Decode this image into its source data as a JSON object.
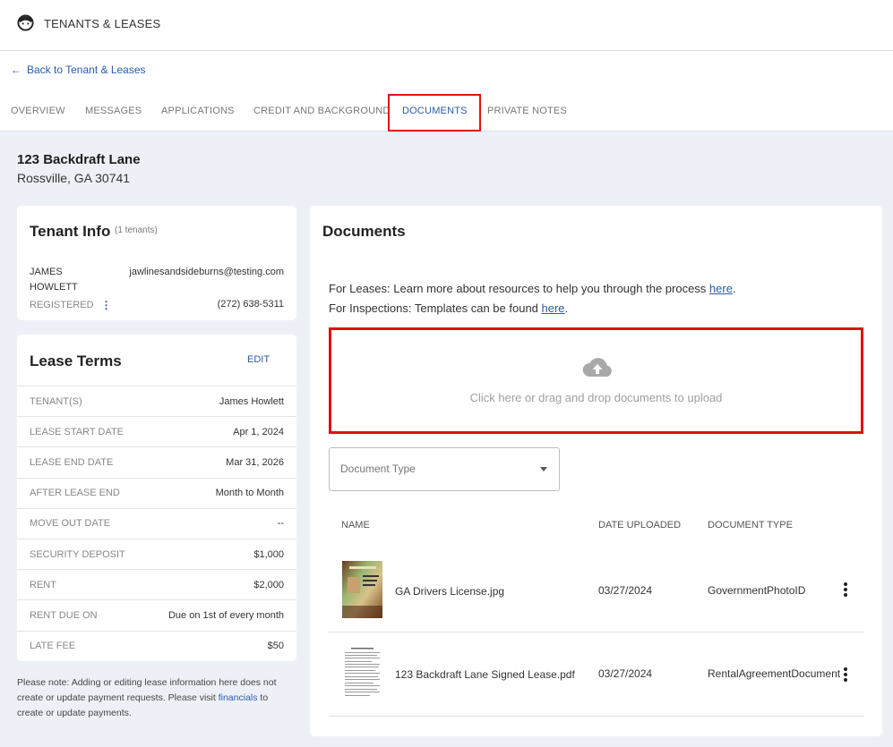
{
  "header": {
    "title": "TENANTS & LEASES",
    "icon": "tenant-face-icon"
  },
  "nav": {
    "back_label": "Back to Tenant & Leases",
    "tabs": [
      {
        "label": "OVERVIEW",
        "active": false
      },
      {
        "label": "MESSAGES",
        "active": false
      },
      {
        "label": "APPLICATIONS",
        "active": false
      },
      {
        "label": "CREDIT AND BACKGROUND",
        "active": false
      },
      {
        "label": "DOCUMENTS",
        "active": true
      },
      {
        "label": "PRIVATE NOTES",
        "active": false
      }
    ]
  },
  "property": {
    "line1": "123 Backdraft Lane",
    "line2": "Rossville, GA 30741"
  },
  "tenant_info": {
    "title": "Tenant Info",
    "count": "(1 tenants)",
    "first_name": "JAMES",
    "last_name": "HOWLETT",
    "status": "REGISTERED",
    "email": "jawlinesandsideburns@testing.com",
    "phone": "(272) 638-5311"
  },
  "lease_terms": {
    "title": "Lease Terms",
    "edit_label": "EDIT",
    "rows": [
      {
        "label": "TENANT(S)",
        "value": "James Howlett"
      },
      {
        "label": "LEASE START DATE",
        "value": "Apr 1, 2024"
      },
      {
        "label": "LEASE END DATE",
        "value": "Mar 31, 2026"
      },
      {
        "label": "AFTER LEASE END",
        "value": "Month to Month"
      },
      {
        "label": "MOVE OUT DATE",
        "value": "--"
      },
      {
        "label": "SECURITY DEPOSIT",
        "value": "$1,000"
      },
      {
        "label": "RENT",
        "value": "$2,000"
      },
      {
        "label": "RENT DUE ON",
        "value": "Due on 1st of every month"
      },
      {
        "label": "LATE FEE",
        "value": "$50"
      }
    ]
  },
  "note": {
    "prefix": "Please note: Adding or editing lease information here does not create or update payment requests. Please visit ",
    "link": "financials",
    "suffix": " to create or update payments."
  },
  "documents": {
    "title": "Documents",
    "leases_text": "For Leases: Learn more about resources to help you through the process ",
    "inspections_text": "For Inspections: Templates can be found ",
    "link_label": "here",
    "period": ".",
    "upload_hint": "Click here or drag and drop documents to upload",
    "type_placeholder": "Document Type",
    "columns": {
      "name": "NAME",
      "date": "DATE UPLOADED",
      "type": "DOCUMENT TYPE"
    },
    "rows": [
      {
        "name": "GA Drivers License.jpg",
        "date": "03/27/2024",
        "type": "GovernmentPhotoID"
      },
      {
        "name": "123 Backdraft Lane Signed Lease.pdf",
        "date": "03/27/2024",
        "type": "RentalAgreementDocument"
      }
    ]
  },
  "colors": {
    "accent": "#2a5ca8",
    "highlight": "#e01010",
    "background": "#edf1f7"
  }
}
